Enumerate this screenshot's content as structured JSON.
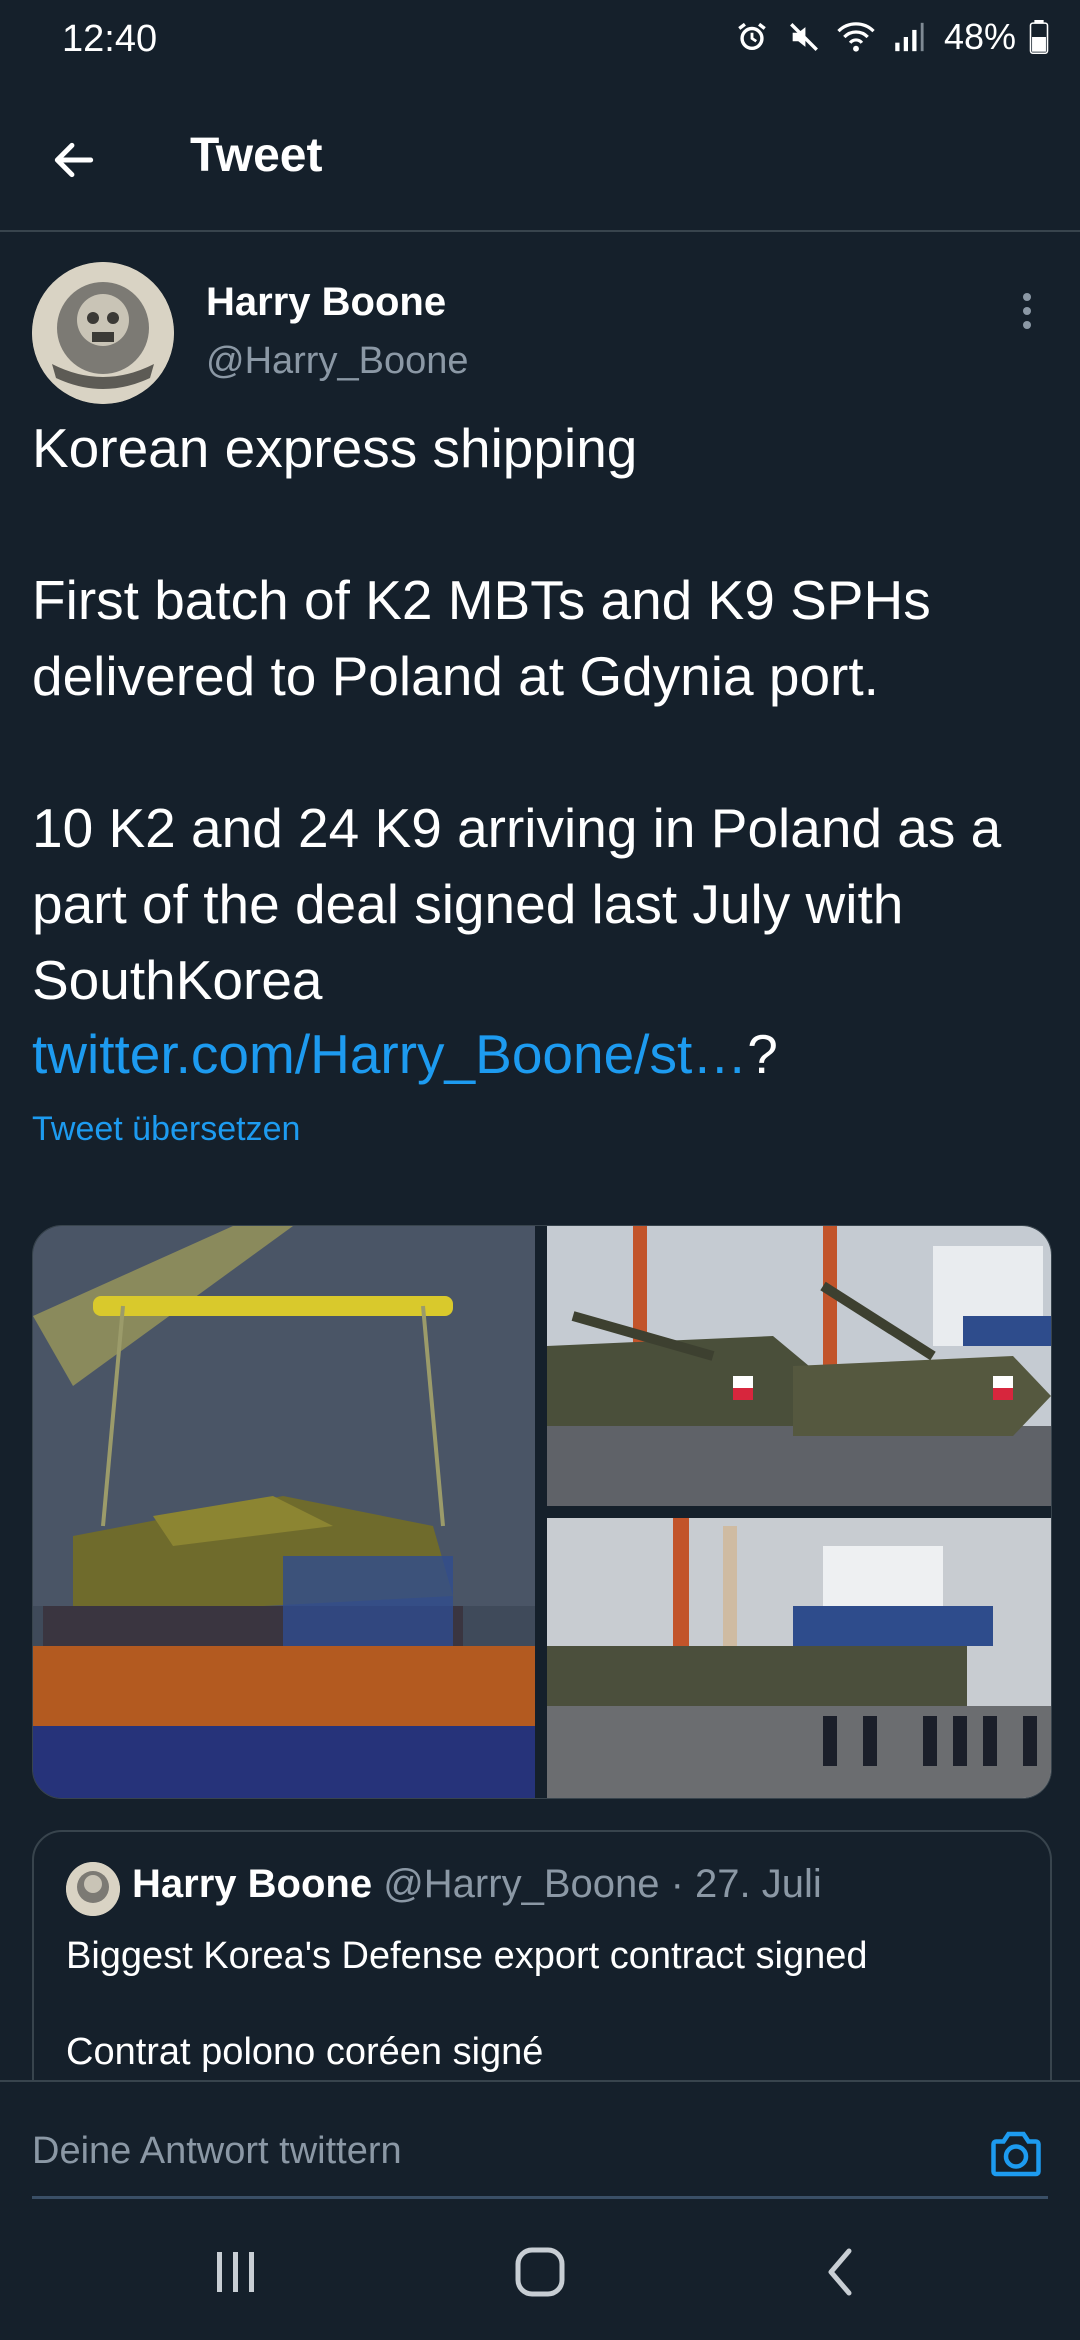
{
  "status_bar": {
    "time": "12:40",
    "battery": "48%",
    "icons": [
      "alarm-icon",
      "mute-icon",
      "wifi-icon",
      "signal-icon",
      "battery-icon"
    ]
  },
  "appbar": {
    "title": "Tweet",
    "back_icon": "arrow-left-icon"
  },
  "tweet": {
    "author_name": "Harry Boone",
    "author_handle": "@Harry_Boone",
    "text": "Korean express shipping\n\nFirst batch of K2 MBTs and K9 SPHs delivered to Poland at Gdynia port.\n\n10 K2 and 24 K9 arriving in Poland as a part of the deal signed last July with SouthKorea",
    "link": "twitter.com/Harry_Boone/st…",
    "link_suffix": "?",
    "translate": "Tweet übersetzen",
    "media_count": 3
  },
  "quoted_tweet": {
    "author_name": "Harry Boone",
    "meta": "@Harry_Boone · 27. Juli",
    "text": "Biggest Korea's Defense export contract signed\n\nContrat polono coréen signé"
  },
  "reply": {
    "placeholder": "Deine Antwort twittern",
    "camera_icon": "camera-icon"
  },
  "colors": {
    "background": "#15202b",
    "accent": "#1d9bf0",
    "secondary_text": "#8b98a5",
    "divider": "#38444d"
  }
}
